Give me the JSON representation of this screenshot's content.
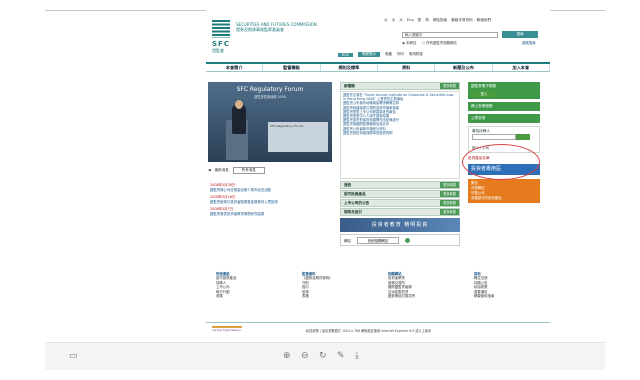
{
  "header": {
    "org_en": "SECURITIES AND FUTURES COMMISSION",
    "org_cn": "證券及期貨事務監察委員會",
    "logo_text": "SFC",
    "logo_cn": "證監會",
    "top_links": [
      "大",
      "大",
      "大",
      "Eng",
      "繁",
      "简",
      "網站指南",
      "聯絡本會資料",
      "聯絡我們"
    ],
    "search_placeholder": "輸入關鍵字",
    "search_button": "搜尋",
    "search_options": [
      "本網站",
      "所有證監會相關網站"
    ],
    "advanced_search": "進階搜尋",
    "subrow": [
      "RSS",
      "電郵提示",
      "收藏",
      "列印"
    ],
    "subrow_extra": "常用詞彙"
  },
  "nav": [
    "本會簡介",
    "監管職能",
    "規則及標準",
    "資料",
    "新聞及公布",
    "加入本會"
  ],
  "banner": {
    "title": "SFC Regulatory Forum",
    "subtitle": "證監會監管論壇 2008",
    "backdrop_text": "SFC Regulatory Forum",
    "nav_label": "最新消息",
    "select_value": "所有消息"
  },
  "left_news": [
    {
      "date": "2008年5月28日",
      "text": "證監會與公司註冊處合辦十周年紀念活動 "
    },
    {
      "date": "2008年5月16日",
      "text": "證監會就修訂投資者賠償基金徵費向公眾諮詢"
    },
    {
      "date": "2008年5月7日",
      "text": "證監會發表投資者教育專題研究結果"
    }
  ],
  "center": {
    "news_head": "新聞稿",
    "more": "更多新聞",
    "news_items": [
      "證監會主席在 \"South Annual Institute on Corporate & Securities Law in Hong Kong 2008\" 上發表的主題演說",
      "證監會公布與內地機構簽署諒解備忘錄",
      "證監會就建議修訂規則諮詢市場參與者",
      "證監會發表上市公司披露事宜的報告",
      "證監會發表中介人操守調查結果",
      "證監會宣布對某投資顧問作出紀律處分",
      "證監會與國際監管機構加強合作",
      "證監會公布最新市場統計資料",
      "證監會就投資者保障事宜發表聲明"
    ],
    "sections": [
      "通告",
      "認可投資產品",
      "上市公司的公告",
      "規則及指引"
    ],
    "edu_banner": "投資者教育 精明投資",
    "link_label": "網站",
    "link_select": "其他相關網站"
  },
  "right": {
    "box1": "證監會電子服務",
    "box1_btn": "登入",
    "box2": "網上查冊服務",
    "box3": "公眾查冊",
    "search_head": "尋找持牌人",
    "search_link": "個人 / 公司",
    "red_link": "投資產品名單",
    "blue_banner": "投資者專用區",
    "orange_head": "警告",
    "orange_items": [
      "可疑網站",
      "可疑公司",
      "未獲認可的投資產品"
    ]
  },
  "footer": {
    "cols": [
      {
        "head": "快速連結",
        "items": [
          "認可投資產品",
          "持牌人",
          "上市公司",
          "執行行動",
          "收購"
        ]
      },
      {
        "head": "監管資料",
        "items": [
          "《證券及期貨條例》",
          "守則",
          "指引",
          "諮詢",
          "表格"
        ]
      },
      {
        "head": "相關網站",
        "items": [
          "投資者教育",
          "香港交易所",
          "國際證監會組織",
          "亞洲區委員會",
          "證券業檢討委員會"
        ]
      },
      {
        "head": "其他",
        "items": [
          "職位空缺",
          "採購公告",
          "私隱政策",
          "重要通告",
          "網頁使用指南"
        ]
      }
    ],
    "bottom_text": "私隱政策 | 最佳瀏覽模式 1024 x 768 解像度並使用 Internet Explorer 6.0 或以上版本",
    "copyright": "© 2008 證券及期貨事務監察委員會 版權所有",
    "caring": "caring organisation"
  }
}
